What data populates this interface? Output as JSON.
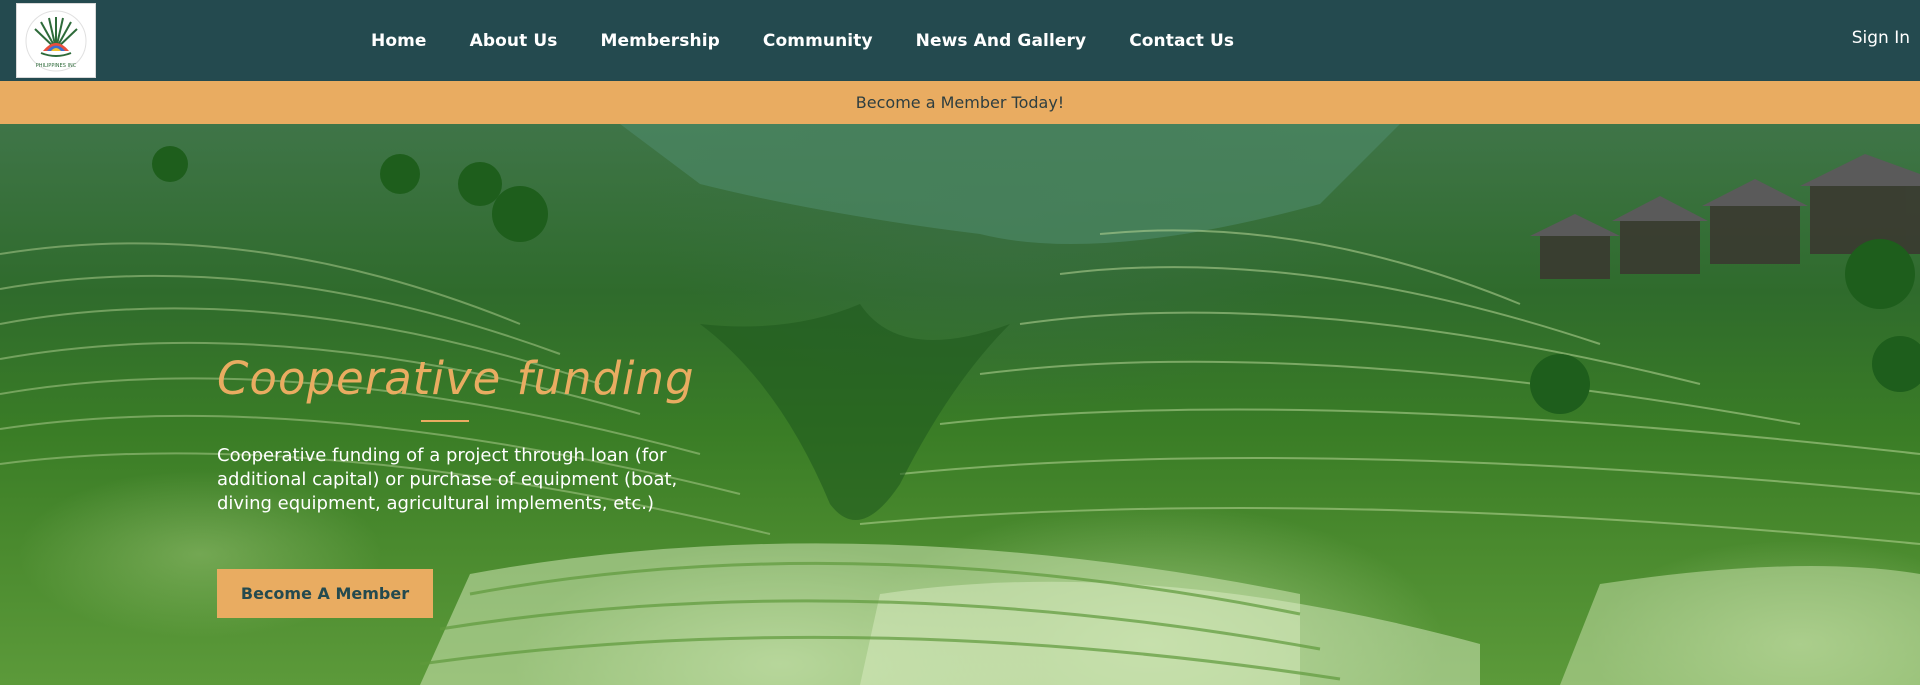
{
  "header": {
    "logo_icon": "society-logo-emblem",
    "nav": [
      {
        "label": "Home"
      },
      {
        "label": "About Us"
      },
      {
        "label": "Membership"
      },
      {
        "label": "Community"
      },
      {
        "label": "News And Gallery"
      },
      {
        "label": "Contact Us"
      }
    ],
    "sign_in": "Sign In"
  },
  "promo": {
    "text": "Become a Member Today!"
  },
  "hero": {
    "title": "Cooperative funding",
    "description": "Cooperative funding of a project through loan (for additional capital) or purchase of equipment (boat, diving equipment, agricultural implements, etc.)",
    "cta_label": "Become A Member",
    "background": "rice-terraces-photo"
  },
  "colors": {
    "header_bg": "#244a4f",
    "accent": "#e9ac61",
    "text_light": "#ffffff"
  }
}
